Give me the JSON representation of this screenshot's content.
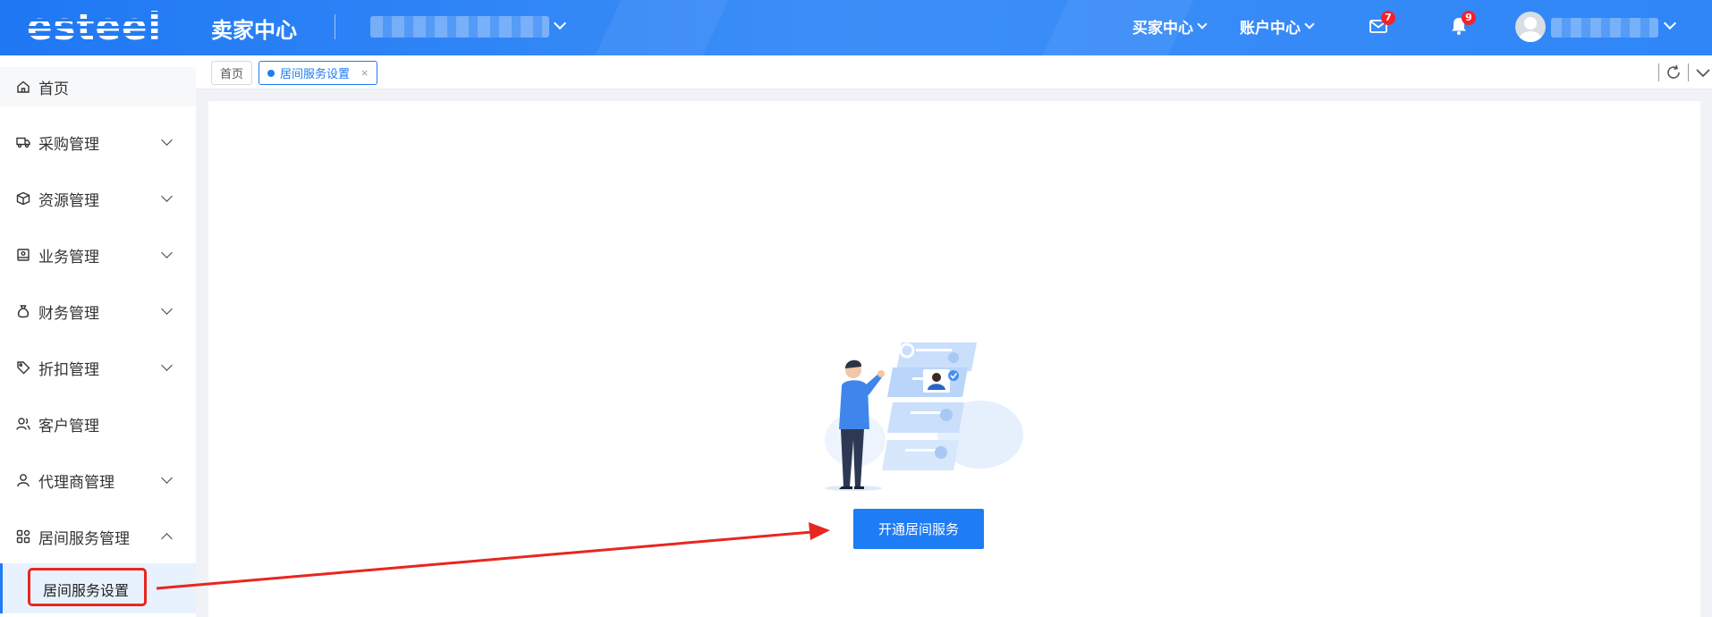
{
  "header": {
    "logo": "esteel",
    "title": "卖家中心",
    "nav": [
      "买家中心",
      "账户中心"
    ],
    "mail_badge": "7",
    "bell_badge": "9",
    "store_select_icon": "chevron-down-icon",
    "user_menu_icon": "chevron-down-icon"
  },
  "sidebar": {
    "items": [
      {
        "label": "首页",
        "icon": "home-icon",
        "expandable": false
      },
      {
        "label": "采购管理",
        "icon": "truck-icon",
        "expandable": true
      },
      {
        "label": "资源管理",
        "icon": "box-icon",
        "expandable": true
      },
      {
        "label": "业务管理",
        "icon": "book-icon",
        "expandable": true
      },
      {
        "label": "财务管理",
        "icon": "money-bag-icon",
        "expandable": true
      },
      {
        "label": "折扣管理",
        "icon": "tag-icon",
        "expandable": true
      },
      {
        "label": "客户管理",
        "icon": "users-icon",
        "expandable": false
      },
      {
        "label": "代理商管理",
        "icon": "agent-icon",
        "expandable": true
      },
      {
        "label": "居间服务管理",
        "icon": "grid-icon",
        "expandable": true,
        "expanded": true
      }
    ],
    "sub_item": {
      "label": "居间服务设置",
      "active": true
    }
  },
  "tabs": {
    "items": [
      {
        "label": "首页",
        "active": false
      },
      {
        "label": "居间服务设置",
        "active": true,
        "close": "×"
      }
    ],
    "tools": [
      "refresh-icon",
      "chevron-down-icon"
    ]
  },
  "content": {
    "button_label": "开通居间服务"
  },
  "colors": {
    "primary": "#1e7cf5",
    "header": "#2f86f7",
    "annotation": "#e8261f",
    "badge": "#f5222d"
  }
}
